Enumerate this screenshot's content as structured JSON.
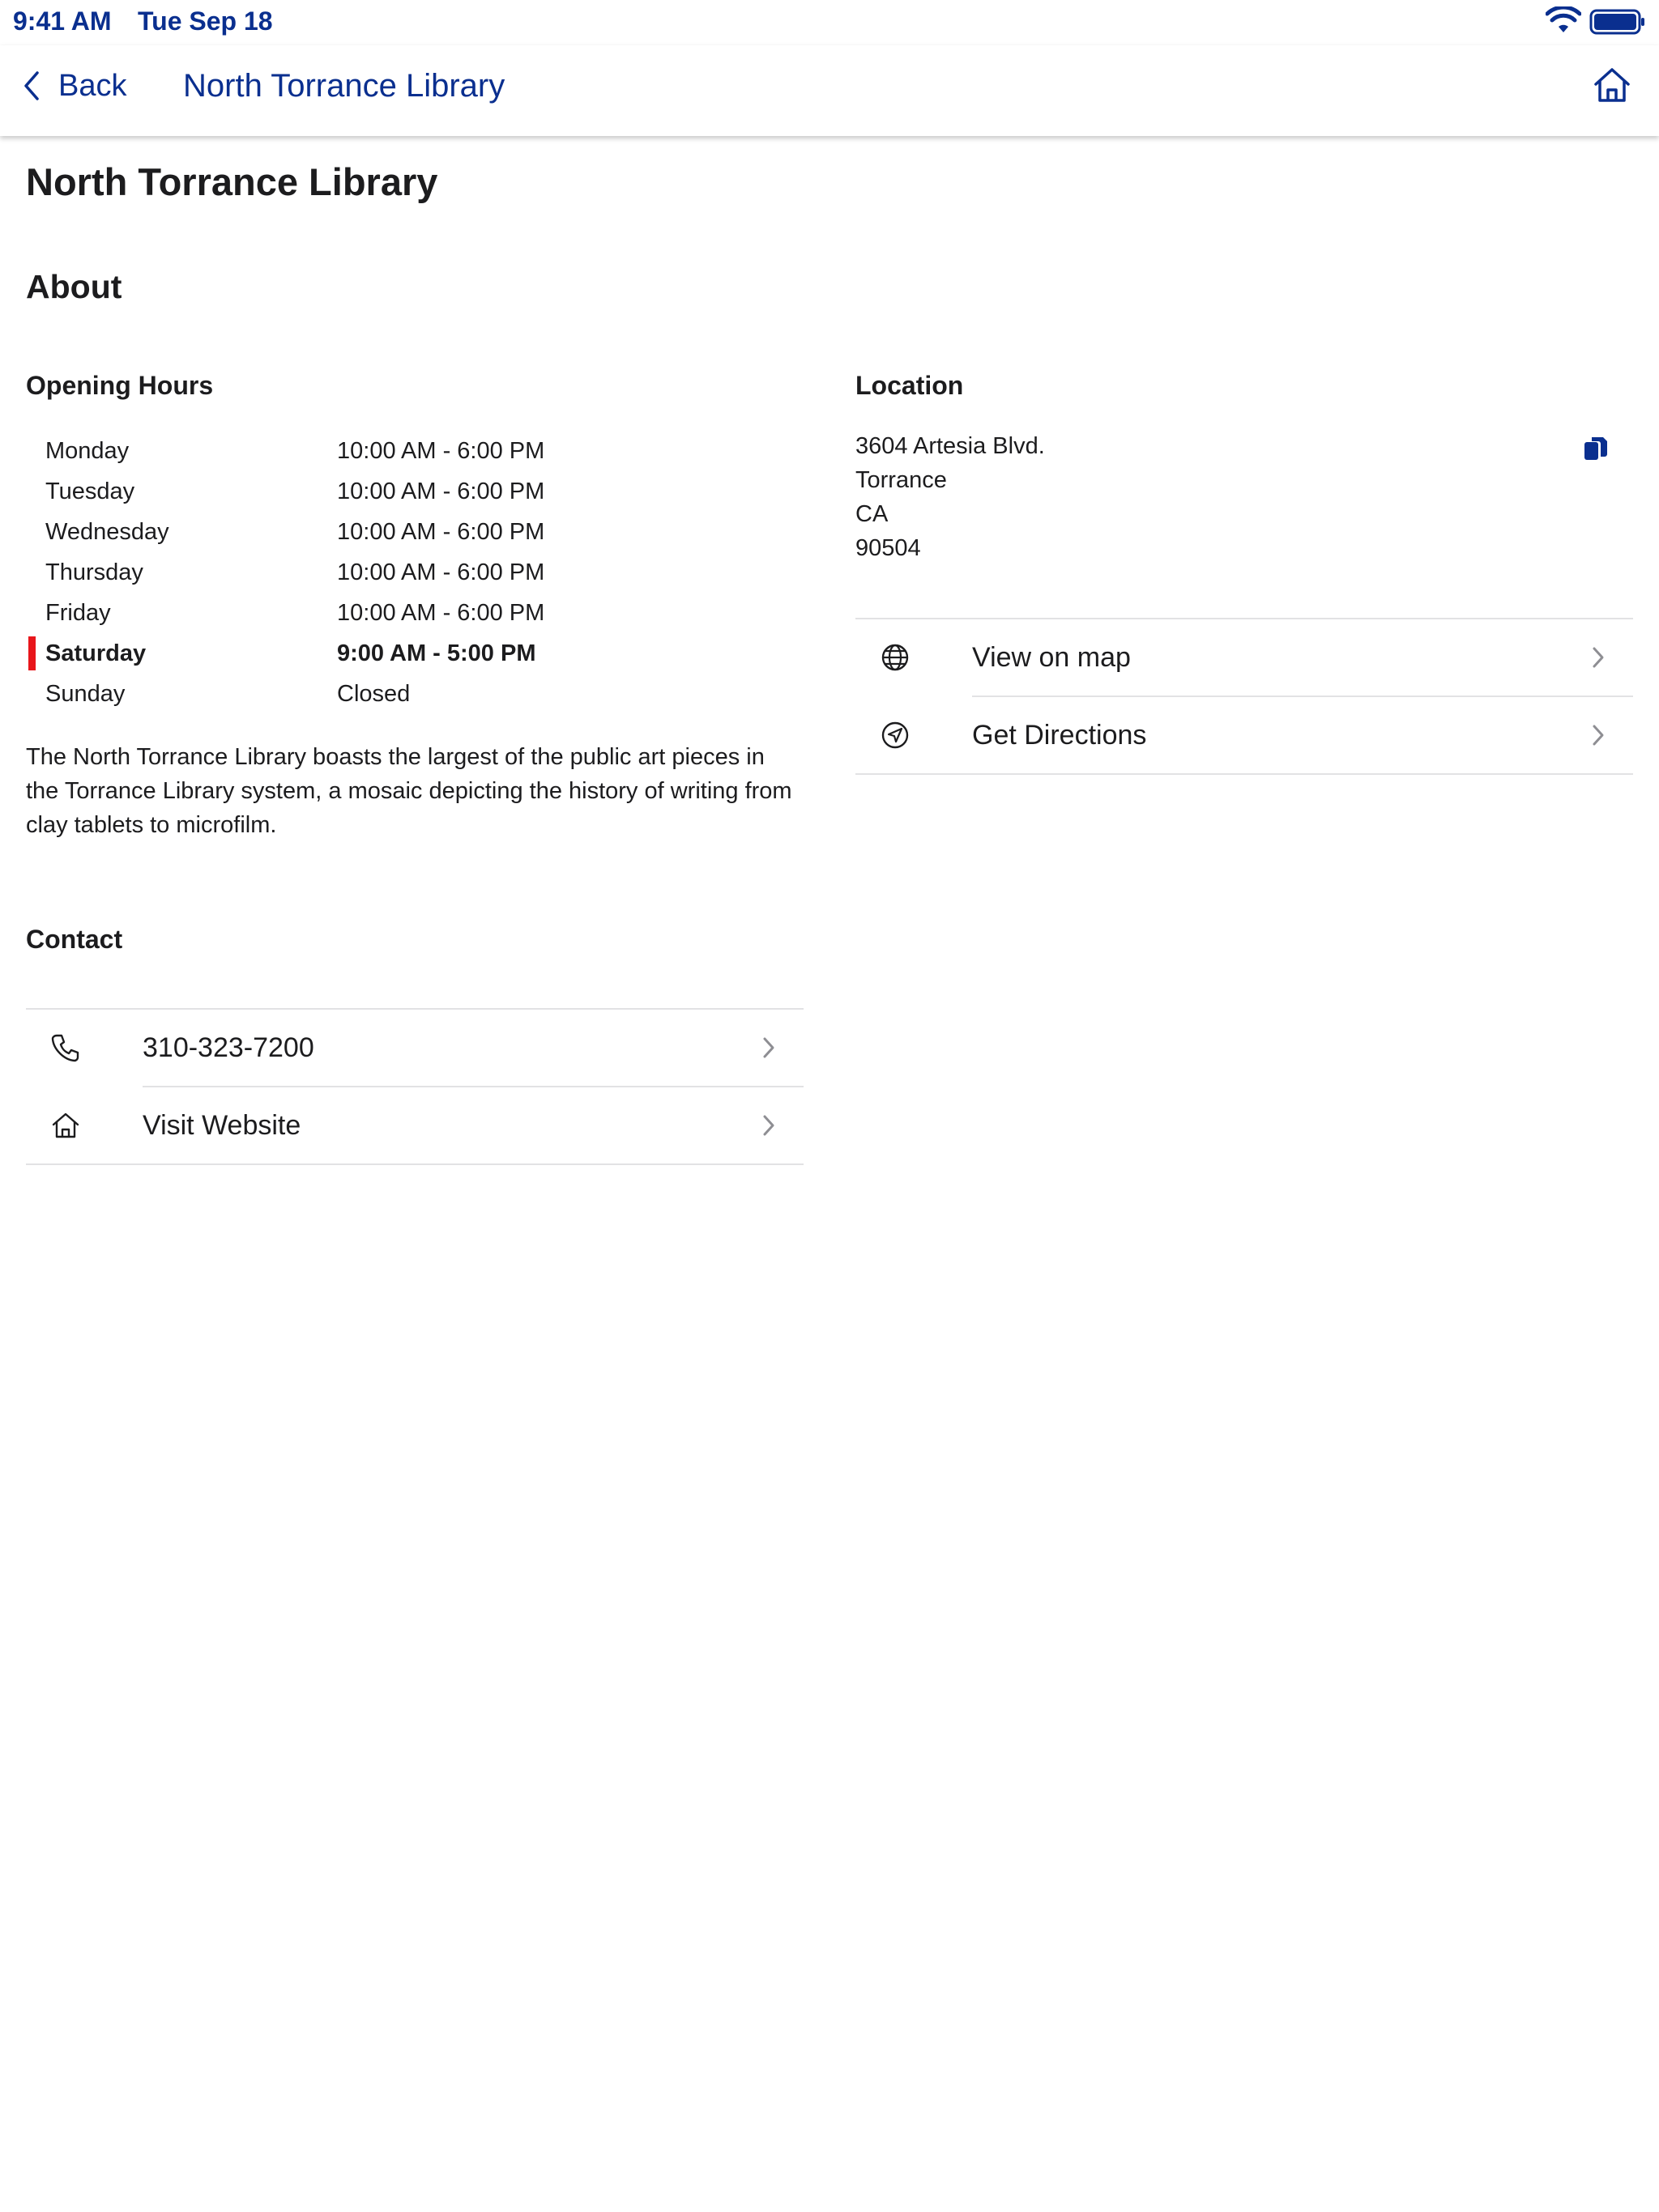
{
  "status_bar": {
    "time": "9:41 AM",
    "date": "Tue Sep 18"
  },
  "nav": {
    "back_label": "Back",
    "title": "North Torrance Library",
    "home_icon": "home-icon"
  },
  "page": {
    "title": "North Torrance Library"
  },
  "about": {
    "heading": "About",
    "hours_heading": "Opening Hours",
    "hours": [
      {
        "day": "Monday",
        "time": "10:00 AM - 6:00 PM",
        "today": false
      },
      {
        "day": "Tuesday",
        "time": "10:00 AM - 6:00 PM",
        "today": false
      },
      {
        "day": "Wednesday",
        "time": "10:00 AM - 6:00 PM",
        "today": false
      },
      {
        "day": "Thursday",
        "time": "10:00 AM - 6:00 PM",
        "today": false
      },
      {
        "day": "Friday",
        "time": "10:00 AM - 6:00 PM",
        "today": false
      },
      {
        "day": "Saturday",
        "time": "9:00 AM - 5:00 PM",
        "today": true
      },
      {
        "day": "Sunday",
        "time": "Closed",
        "today": false
      }
    ],
    "description": "The North Torrance Library boasts the largest of the public art pieces in the Torrance Library system, a mosaic depicting the history of writing from clay tablets to microfilm."
  },
  "contact": {
    "heading": "Contact",
    "items": [
      {
        "label": "310-323-7200",
        "icon": "phone-icon"
      },
      {
        "label": "Visit Website",
        "icon": "home-icon"
      }
    ]
  },
  "location": {
    "heading": "Location",
    "address_lines": [
      "3604 Artesia Blvd.",
      "Torrance",
      "CA",
      "90504"
    ],
    "copy_icon": "copy-icon",
    "items": [
      {
        "label": "View on map",
        "icon": "globe-icon"
      },
      {
        "label": "Get Directions",
        "icon": "navigation-arrow-icon"
      }
    ]
  },
  "colors": {
    "accent": "#0a2f8f",
    "today_marker": "#e8161b",
    "divider": "#e2e2e4",
    "text": "#1c1c1e"
  }
}
